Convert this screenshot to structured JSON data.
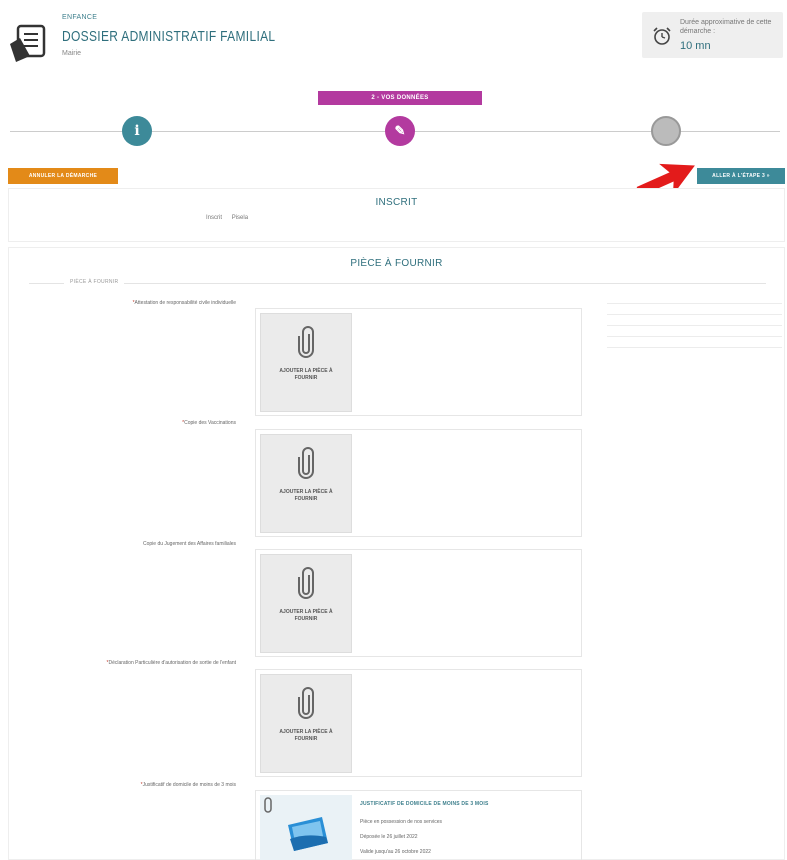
{
  "header": {
    "category": "ENFANCE",
    "title": "DOSSIER ADMINISTRATIF FAMILIAL",
    "subtitle": "Mairie",
    "duration_label": "Durée approximative de cette démarche :",
    "duration_value": "10 mn"
  },
  "steps": {
    "current_label": "2 - VOS DONNÉES",
    "icons": [
      "info-icon",
      "pencil-icon",
      "empty-circle-icon"
    ]
  },
  "actions": {
    "cancel_label": "ANNULER LA DÉMARCHE",
    "next_label": "ALLER À L'ÉTAPE 3 »"
  },
  "inscrit": {
    "title": "INSCRIT",
    "field_label": "Inscrit",
    "field_value": "Pisela"
  },
  "pieces": {
    "title": "PIÈCE À FOURNIR",
    "legend": "PIÈCE À FOURNIR",
    "upload_label": "AJOUTER LA PIÈCE À FOURNIR",
    "items": [
      {
        "label": "Attestation de responsabilité civile individuelle",
        "required": true
      },
      {
        "label": "Copie des Vaccinations",
        "required": true
      },
      {
        "label": "Copie du Jugement des Affaires familiales",
        "required": false
      },
      {
        "label": "Déclaration Particulière d'autorisation de sortie de l'enfant",
        "required": true
      },
      {
        "label": "Justificatif de domicile de moins de 3 mois",
        "required": true
      }
    ],
    "document": {
      "title": "JUSTIFICATIF DE DOMICILE DE MOINS DE 3 MOIS",
      "status": "Pièce en possession de nos services",
      "deposited": "Déposée le 26 juillet 2022",
      "valid_until": "Valide jusqu'au 26 octobre 2022"
    }
  }
}
